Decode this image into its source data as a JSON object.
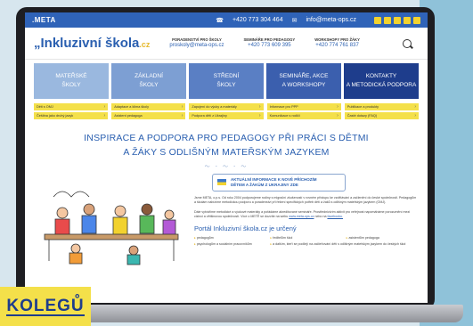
{
  "topbar": {
    "brand": ".META",
    "phone": "+420 773 304 464",
    "email": "info@meta-ops.cz"
  },
  "header": {
    "logo_main": "„Inkluzivní škola",
    "logo_suffix": ".cz",
    "blocks": [
      {
        "title": "PORADENSTVÍ PRO ŠKOLY",
        "value": "proskoly@meta-ops.cz"
      },
      {
        "title": "SEMINÁŘE PRO PEDAGOGY",
        "value": "+420 773 609 395"
      },
      {
        "title": "WORKSHOPY PRO ŽÁKY",
        "value": "+420 774 761 837"
      }
    ]
  },
  "nav": [
    {
      "label1": "MATEŘSKÉ",
      "label2": "ŠKOLY"
    },
    {
      "label1": "ZÁKLADNÍ",
      "label2": "ŠKOLY"
    },
    {
      "label1": "STŘEDNÍ",
      "label2": "ŠKOLY"
    },
    {
      "label1": "SEMINÁŘE, AKCE",
      "label2": "A WORKSHOPY"
    },
    {
      "label1": "KONTAKTY",
      "label2": "A METODICKÁ PODPORA"
    }
  ],
  "links": [
    "Děti s OMJ",
    "Adaptace a klima školy",
    "Zapojení do výuky a materiály",
    "Informace pro PPP",
    "Publikace a produkty",
    "Čeština jako druhý jazyk",
    "Asistent pedagoga",
    "Podpora dětí z Ukrajiny",
    "Komunikace s rodiči",
    "Časté dotazy (FAQ)"
  ],
  "main": {
    "title_line1": "INSPIRACE A PODPORA PRO PEDAGOGY PŘI PRÁCI S DĚTMI",
    "title_line2": "A ŽÁKY S ODLIŠNÝM MATEŘSKÝM JAZYKEM",
    "notice_line1": "AKTUÁLNÍ INFORMACE K NOVĚ PŘÍCHOZÍM",
    "notice_line2": "DĚTEM A ŽÁKŮM Z UKRAJINY ZDE",
    "para1": "Jsme META, o.p.s. Od roku 2004 podporujeme rodiny s migrační zkušeností v rovném přístupu ke vzdělávání a začlenění do české společnosti. Pedagogům a školám nabízíme metodickou podporu a poradenství při řešení specifických potřeb dětí a žáků s odlišným mateřským jazykem (OMJ).",
    "para2": "Dále vytváříme metodické a výukové materiály a pořádáme akreditované semináře. Prostřednictvím aktivit pro veřejnost napomáháme porozumění mezi cizinci a většinovou společností. Více o METĚ se dozvíte na webu",
    "para2_link": "www.meta-ops.cz",
    "para2_end": "nebo na",
    "para2_link2": "facebooku.",
    "portal": "Portál Inkluzivní škola.cz je určený",
    "targets": [
      "pedagogům",
      "ředitelům škol",
      "asistentům pedagoga",
      "psychologům a sociálním pracovníkům",
      "a dalším, kteří se podílejí na začleňování dětí s odlišným mateřským jazykem do českých škol"
    ]
  },
  "badge": "KOLEGŮ",
  "colors": {
    "accent": "#2a5fb0",
    "yellow": "#f4e04a",
    "dark_blue": "#1e3d8c"
  }
}
